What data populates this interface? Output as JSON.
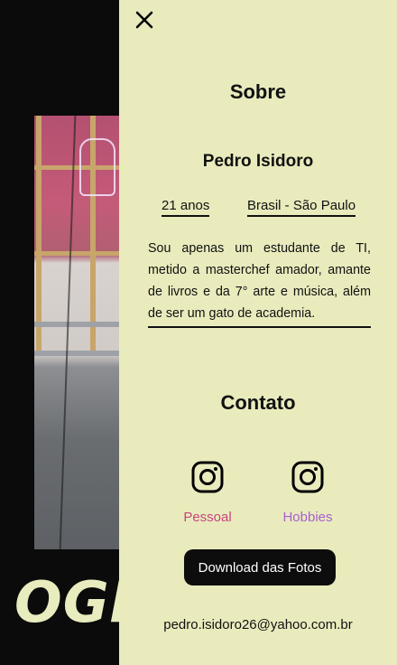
{
  "background": {
    "brand_text": "OGR"
  },
  "panel": {
    "about_title": "Sobre",
    "name": "Pedro Isidoro",
    "age": "21 anos",
    "location": "Brasil - São Paulo",
    "bio": "Sou apenas um estudante de TI, metido a masterchef amador, amante de livros e da 7° arte e música, além de ser um gato de academia.",
    "contact_title": "Contato",
    "social": [
      {
        "label": "Pessoal",
        "icon": "instagram-icon",
        "color": "#c7457e"
      },
      {
        "label": "Hobbies",
        "icon": "instagram-icon",
        "color": "#a85fd0"
      }
    ],
    "download_label": "Download das Fotos",
    "email": "pedro.isidoro26@yahoo.com.br"
  },
  "colors": {
    "panel_bg": "#e9ebbd",
    "page_bg": "#0b0b0b",
    "button_bg": "#0d0d0d"
  }
}
